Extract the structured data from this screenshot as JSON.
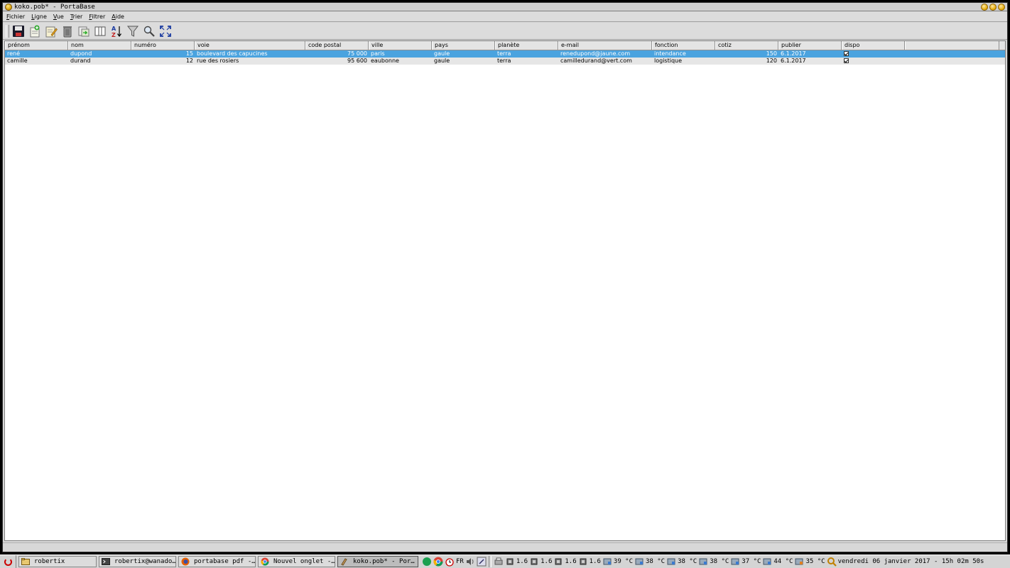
{
  "window": {
    "title": "koko.pob* - PortaBase"
  },
  "menu": [
    "Fichier",
    "Ligne",
    "Vue",
    "Trier",
    "Filtrer",
    "Aide"
  ],
  "toolbar": {
    "buttons": [
      "save-icon",
      "add-row-icon",
      "edit-icon",
      "delete-icon",
      "copy-icon",
      "columns-icon",
      "sort-icon",
      "filter-icon",
      "search-icon",
      "fullscreen-icon"
    ]
  },
  "table": {
    "columns": [
      "prénom",
      "nom",
      "numéro",
      "voie",
      "code postal",
      "ville",
      "pays",
      "planète",
      "e-mail",
      "fonction",
      "cotiz",
      "publier",
      "dispo",
      ""
    ],
    "rows": [
      [
        "rené",
        "dupond",
        "15",
        "boulevard des capucines",
        "75 000",
        "paris",
        "gaule",
        "terra",
        "renedupond@jaune.com",
        "intendance",
        "150",
        "6.1.2017",
        "✔"
      ],
      [
        "camille",
        "durand",
        "12",
        "rue des rosiers",
        "95 600",
        "eaubonne",
        "gaule",
        "terra",
        "camilledurand@vert.com",
        "logistique",
        "120",
        "6.1.2017",
        "✔"
      ]
    ],
    "selected_row": 0,
    "accent_color": "#4aa3df"
  },
  "taskbar": {
    "tasks": [
      {
        "label": "robertix",
        "icon": "folder-icon"
      },
      {
        "label": "robertix@wanado…",
        "icon": "terminal-icon"
      },
      {
        "label": "portabase pdf -…",
        "icon": "firefox-icon"
      },
      {
        "label": "Nouvel onglet -…",
        "icon": "chrome-icon"
      },
      {
        "label": "koko.pob* - Por…",
        "icon": "portabase-icon"
      }
    ],
    "keyboard_layout": "FR",
    "cpu_values": [
      "1.6",
      "1.6",
      "1.6",
      "1.6"
    ],
    "temperatures": [
      "39 °C",
      "38 °C",
      "38 °C",
      "38 °C",
      "37 °C",
      "44 °C",
      "35 °C"
    ],
    "clock": "vendredi 06 janvier 2017 - 15h 02m 50s"
  }
}
